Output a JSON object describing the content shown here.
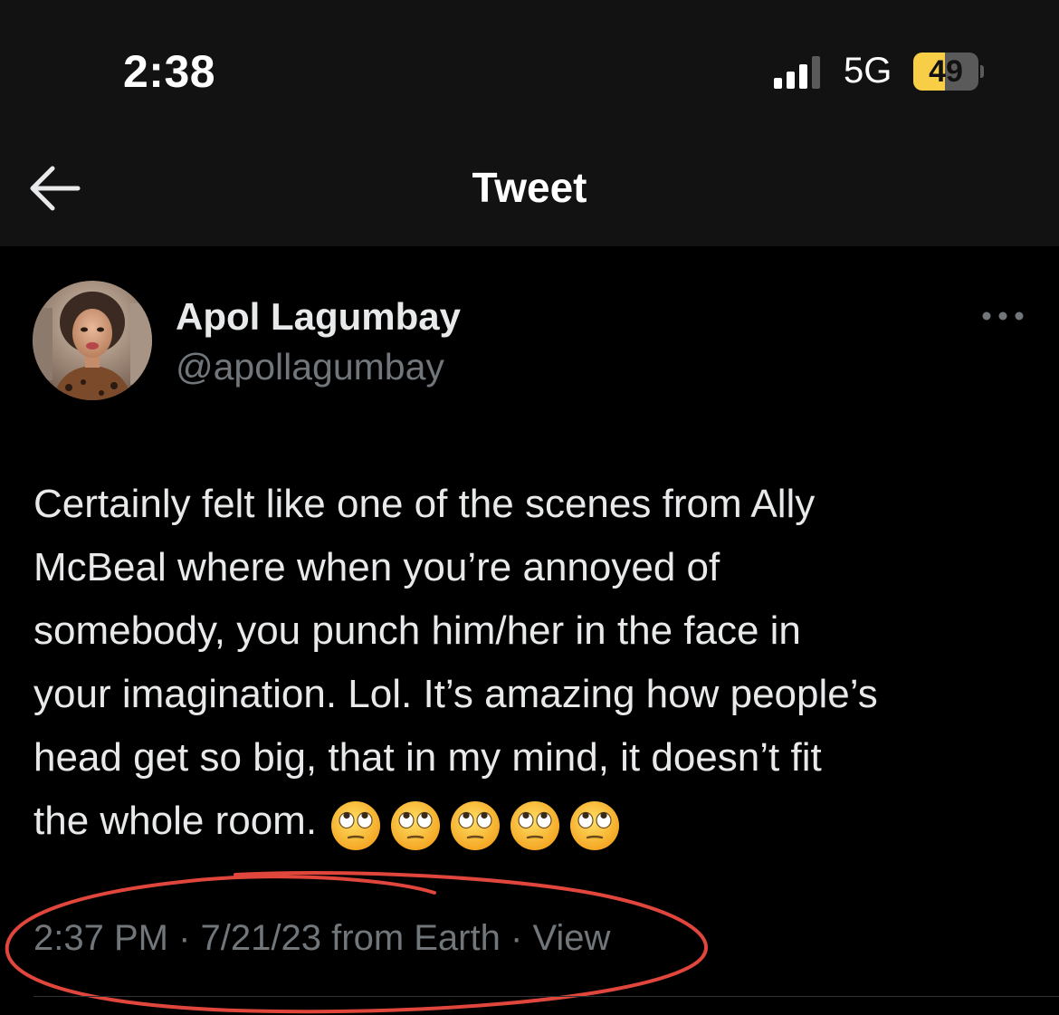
{
  "status_bar": {
    "time": "2:38",
    "network": "5G",
    "battery": "49",
    "battery_level": 0.49,
    "signal_icon": "signal-bars-icon",
    "battery_icon": "battery-icon"
  },
  "nav": {
    "back_icon": "arrow-left-icon",
    "title": "Tweet"
  },
  "tweet": {
    "author_name": "Apol Lagumbay",
    "author_handle": "@apollagumbay",
    "more_icon": "ellipsis-icon",
    "text_lines": [
      "Certainly felt like one of the scenes from Ally",
      "McBeal where when you’re annoyed of",
      "somebody, you punch him/her in the face in",
      "your imagination. Lol. It’s amazing how people’s",
      "head get so big, that in my mind, it doesn’t fit",
      "the whole room."
    ],
    "emoji": "🙄🙄🙄🙄🙄",
    "emoji_icon": "face-with-rolling-eyes-icon",
    "meta": {
      "time": "2:37 PM",
      "separator": "·",
      "date": "7/21/23",
      "source": "from Earth",
      "view": "View"
    }
  },
  "colors": {
    "background": "#000000",
    "header_background": "#121212",
    "primary_text": "#e7e9ea",
    "secondary_text": "#71767b",
    "battery": "#f7ce46",
    "annotation": "#e0463c",
    "divider": "#2f3336"
  }
}
